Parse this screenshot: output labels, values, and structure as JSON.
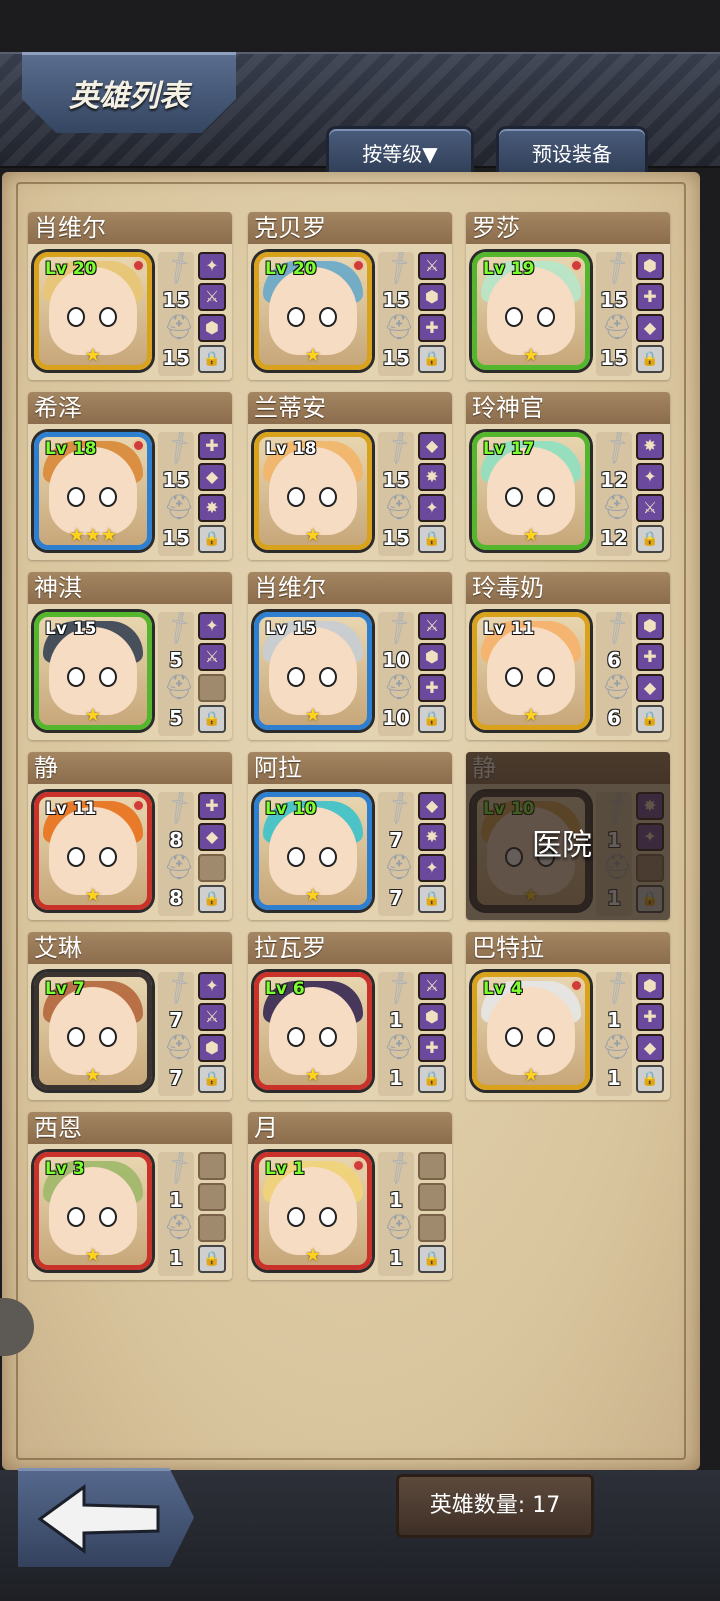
{
  "header": {
    "title": "英雄列表",
    "sort_label": "按等级▼",
    "preset_label": "预设装备"
  },
  "footer": {
    "hero_count_label": "英雄数量: 17"
  },
  "heroes": [
    {
      "name": "肖维尔",
      "level": "Lv 20",
      "atk": "15",
      "def": "15",
      "stars": "★",
      "frame": "gold",
      "notif": true,
      "equip": [
        "item",
        "item",
        "item",
        "lock"
      ]
    },
    {
      "name": "克贝罗",
      "level": "Lv 20",
      "atk": "15",
      "def": "15",
      "stars": "★",
      "frame": "gold",
      "notif": true,
      "equip": [
        "item",
        "item",
        "item",
        "lock"
      ]
    },
    {
      "name": "罗莎",
      "level": "Lv 19",
      "atk": "15",
      "def": "15",
      "stars": "★",
      "frame": "green",
      "notif": true,
      "equip": [
        "item",
        "item",
        "item",
        "lock"
      ]
    },
    {
      "name": "希泽",
      "level": "Lv 18",
      "atk": "15",
      "def": "15",
      "stars": "★★★",
      "frame": "blue",
      "notif": true,
      "equip": [
        "item",
        "item",
        "item",
        "lock"
      ]
    },
    {
      "name": "兰蒂安",
      "level": "Lv 18",
      "atk": "15",
      "def": "15",
      "stars": "★",
      "frame": "gold",
      "notif": false,
      "equip": [
        "item",
        "item",
        "item",
        "lock"
      ]
    },
    {
      "name": "玲神官",
      "level": "Lv 17",
      "atk": "12",
      "def": "12",
      "stars": "★",
      "frame": "green",
      "notif": false,
      "equip": [
        "item",
        "item",
        "item",
        "lock"
      ]
    },
    {
      "name": "神淇",
      "level": "Lv 15",
      "atk": "5",
      "def": "5",
      "stars": "★",
      "frame": "green",
      "notif": false,
      "equip": [
        "item",
        "item",
        "empty",
        "lock"
      ]
    },
    {
      "name": "肖维尔",
      "level": "Lv 15",
      "atk": "10",
      "def": "10",
      "stars": "★",
      "frame": "blue",
      "notif": false,
      "equip": [
        "item",
        "item",
        "item",
        "lock"
      ]
    },
    {
      "name": "玲毒奶",
      "level": "Lv 11",
      "atk": "6",
      "def": "6",
      "stars": "★",
      "frame": "gold",
      "notif": false,
      "equip": [
        "item",
        "item",
        "item",
        "lock"
      ]
    },
    {
      "name": "静",
      "level": "Lv 11",
      "atk": "8",
      "def": "8",
      "stars": "★",
      "frame": "red",
      "notif": true,
      "equip": [
        "item",
        "item",
        "empty",
        "lock"
      ]
    },
    {
      "name": "阿拉",
      "level": "Lv 10",
      "atk": "7",
      "def": "7",
      "stars": "★",
      "frame": "blue",
      "notif": false,
      "equip": [
        "item",
        "item",
        "item",
        "lock"
      ]
    },
    {
      "name": "静",
      "level": "Lv 10",
      "atk": "1",
      "def": "1",
      "stars": "★",
      "frame": "dark",
      "notif": false,
      "equip": [
        "item",
        "item",
        "empty",
        "lock"
      ],
      "status": "医院"
    },
    {
      "name": "艾琳",
      "level": "Lv 7",
      "atk": "7",
      "def": "7",
      "stars": "★",
      "frame": "dark",
      "notif": false,
      "equip": [
        "item",
        "item",
        "item",
        "lock"
      ]
    },
    {
      "name": "拉瓦罗",
      "level": "Lv 6",
      "atk": "1",
      "def": "1",
      "stars": "★",
      "frame": "red",
      "notif": false,
      "equip": [
        "item",
        "item",
        "item",
        "lock"
      ]
    },
    {
      "name": "巴特拉",
      "level": "Lv 4",
      "atk": "1",
      "def": "1",
      "stars": "★",
      "frame": "gold",
      "notif": true,
      "equip": [
        "item",
        "item",
        "item",
        "lock"
      ]
    },
    {
      "name": "西恩",
      "level": "Lv 3",
      "atk": "1",
      "def": "1",
      "stars": "★",
      "frame": "red",
      "notif": false,
      "equip": [
        "empty",
        "empty",
        "empty",
        "lock"
      ]
    },
    {
      "name": "月",
      "level": "Lv 1",
      "atk": "1",
      "def": "1",
      "stars": "★",
      "frame": "red",
      "notif": true,
      "equip": [
        "empty",
        "empty",
        "empty",
        "lock"
      ]
    }
  ],
  "colors": {
    "frame_gold": "#d9a21c",
    "frame_green": "#54b62c",
    "frame_blue": "#2e7fd0",
    "frame_red": "#c8322a",
    "frame_dark": "#3a3330",
    "level_text": "#7cff2e",
    "star": "#ffd21d",
    "slot_item": "#6b4a9e"
  }
}
